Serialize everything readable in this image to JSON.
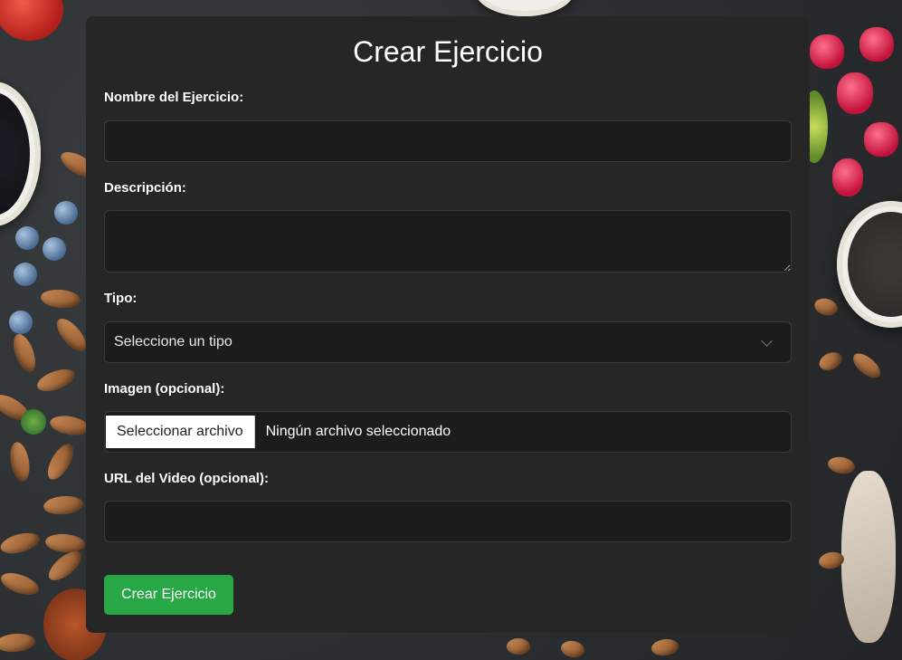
{
  "form": {
    "title": "Crear Ejercicio",
    "fields": {
      "name_label": "Nombre del Ejercicio:",
      "name_value": "",
      "description_label": "Descripción:",
      "description_value": "",
      "type_label": "Tipo:",
      "type_selected": "Seleccione un tipo",
      "image_label": "Imagen (opcional):",
      "image_button": "Seleccionar archivo",
      "image_status": "Ningún archivo seleccionado",
      "video_label": "URL del Video (opcional):",
      "video_value": ""
    },
    "submit_label": "Crear Ejercicio"
  },
  "colors": {
    "card_background": "#262626",
    "input_background": "#1c1c1c",
    "submit_button": "#28a745",
    "text": "#ffffff"
  },
  "icons": {
    "select": "chevron-down-icon"
  }
}
